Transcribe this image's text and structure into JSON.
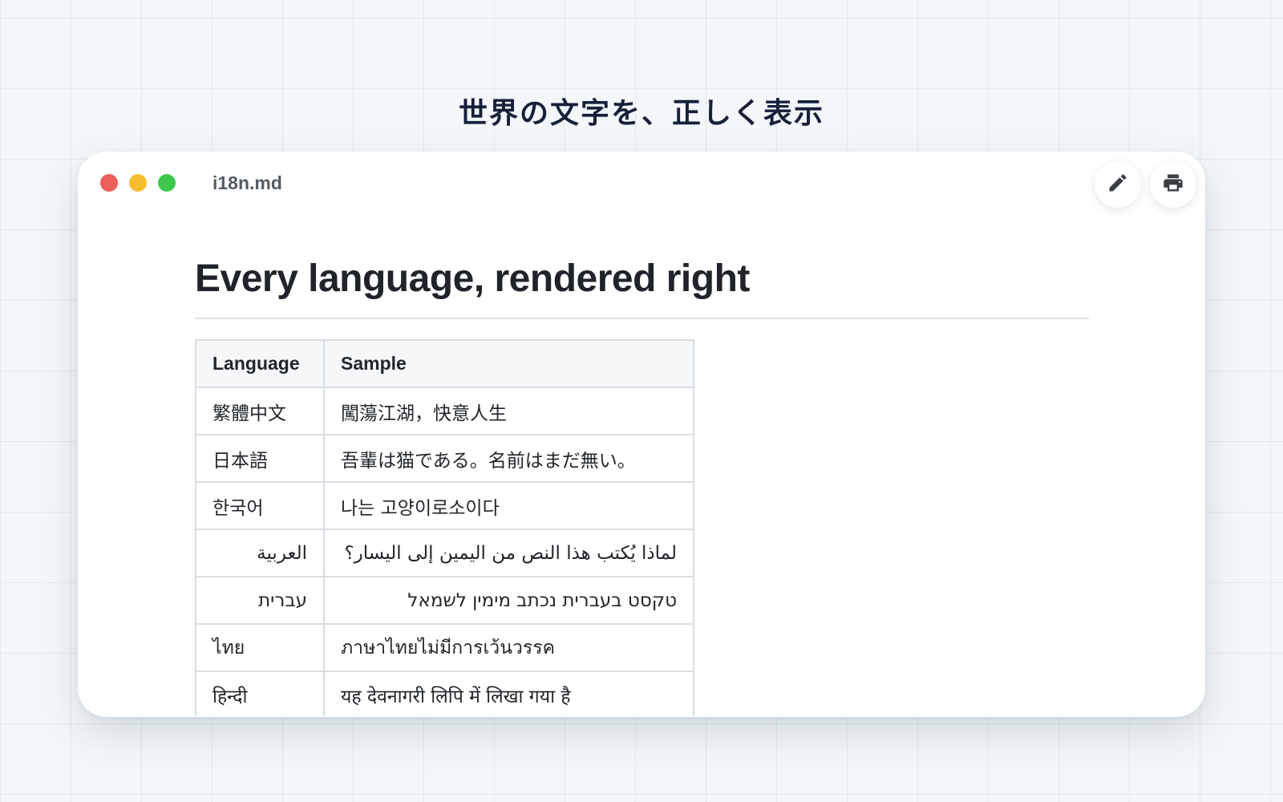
{
  "headline": "世界の文字を、正しく表示",
  "window": {
    "title": "i18n.md",
    "controls": {
      "close_color": "#ec5f5a",
      "minimize_color": "#f4be2f",
      "maximize_color": "#3ec84b"
    },
    "toolbar": {
      "edit_icon": "pencil-icon",
      "print_icon": "printer-icon"
    }
  },
  "document": {
    "heading": "Every language, rendered right",
    "table": {
      "headers": [
        "Language",
        "Sample"
      ],
      "rows": [
        {
          "language": "繁體中文",
          "sample": "闖蕩江湖，快意人生",
          "dir": "ltr"
        },
        {
          "language": "日本語",
          "sample": "吾輩は猫である。名前はまだ無い。",
          "dir": "ltr"
        },
        {
          "language": "한국어",
          "sample": "나는 고양이로소이다",
          "dir": "ltr"
        },
        {
          "language": "العربية",
          "sample": "لماذا يُكتب هذا النص من اليمين إلى اليسار؟",
          "dir": "rtl"
        },
        {
          "language": "עברית",
          "sample": "טקסט בעברית נכתב מימין לשמאל",
          "dir": "rtl"
        },
        {
          "language": "ไทย",
          "sample": "ภาษาไทยไม่มีการเว้นวรรค",
          "dir": "ltr"
        },
        {
          "language": "हिन्दी",
          "sample": "यह देवनागरी लिपि में लिखा गया है",
          "dir": "ltr"
        }
      ]
    }
  }
}
